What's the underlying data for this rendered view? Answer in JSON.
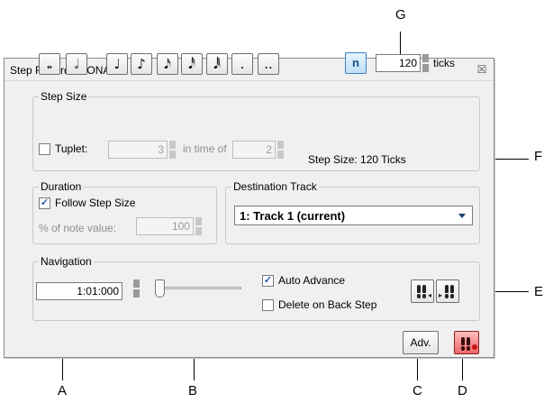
{
  "window": {
    "title": "Step Record - SONAR1",
    "close_glyph": "☒"
  },
  "callouts": {
    "a": "A",
    "b": "B",
    "c": "C",
    "d": "D",
    "e": "E",
    "f": "F",
    "g": "G"
  },
  "step_size": {
    "label": "Step Size",
    "note_buttons": [
      "𝅝",
      "𝅗𝅥",
      "♩",
      "♪",
      "𝅘𝅥𝅯",
      "𝅘𝅥𝅰",
      "𝅘𝅥𝅱",
      ".",
      ".."
    ],
    "n_label": "n",
    "ticks_value": "120",
    "ticks_label": "ticks",
    "tuplet_label": "Tuplet:",
    "tuplet_checked": false,
    "tuplet_value": "3",
    "in_time_of_label": "in time of",
    "in_time_of_value": "2",
    "step_size_text": "Step Size: 120 Ticks"
  },
  "duration": {
    "label": "Duration",
    "follow_label": "Follow Step Size",
    "follow_checked": true,
    "percent_label": "% of note value:",
    "percent_value": "100"
  },
  "destination": {
    "label": "Destination Track",
    "selected": "1: Track 1 (current)"
  },
  "navigation": {
    "label": "Navigation",
    "position_value": "1:01:000",
    "slider_value": 0,
    "auto_advance_label": "Auto Advance",
    "auto_advance_checked": true,
    "delete_label": "Delete on Back Step",
    "delete_checked": false
  },
  "buttons": {
    "adv_label": "Adv."
  },
  "icons": {
    "close": "close-icon",
    "step_back": "footprints-back-icon",
    "step_forward": "footprints-forward-icon",
    "record": "footprints-record-icon",
    "spinner": "spinner-arrows-icon",
    "dropdown": "chevron-down-icon",
    "checkmark": "checkmark-icon"
  },
  "colors": {
    "n_button": "#bfe0f6",
    "record_button": "#f06969",
    "select_text": "#000000"
  }
}
